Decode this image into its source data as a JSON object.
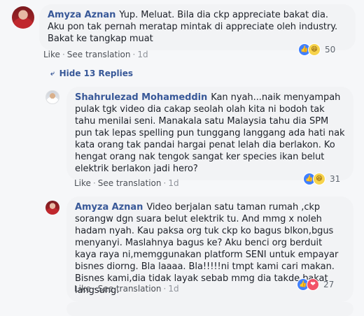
{
  "comments": [
    {
      "author": "Amyza Aznan",
      "text": "Yup. Meluat. Bila dia ckp appreciate bakat dia. Aku pon tak pernah meratap mintak di appreciate oleh industry. Bakat ke tangkap muat",
      "like_label": "Like",
      "translate_label": "See translation",
      "time": "1d",
      "reaction_icons": [
        "like-icon",
        "haha-icon"
      ],
      "reaction_count": "50"
    }
  ],
  "hide_replies_label": "Hide 13 Replies",
  "replies": [
    {
      "author": "Shahrulezad Mohameddin",
      "text": "Kan nyah...naik menyampah pulak tgk video dia cakap seolah olah kita ni bodoh tak tahu menilai seni. Manakala satu Malaysia tahu dia SPM pun tak lepas spelling pun tunggang langgang ada hati nak kata orang tak pandai hargai penat lelah dia berlakon. Ko hengat orang nak tengok sangat ker species ikan belut elektrik berlakon jadi hero?",
      "like_label": "Like",
      "translate_label": "See translation",
      "time": "1d",
      "reaction_icons": [
        "like-icon",
        "haha-icon"
      ],
      "reaction_count": "31"
    },
    {
      "author": "Amyza Aznan",
      "text": "Video berjalan satu taman rumah ,ckp sorangw dgn suara belut elektrik tu. And mmg x noleh hadam nyah. Kau paksa org tuk ckp ko bagus blkon,bgus menyanyi. Maslahnya bagus ke? Aku benci org berduit kaya raya ni,memggunakan platform SENI untuk empayar bisnes diorng. Bla laaaa. Bla!!!!!ni tmpt kami cari makan. Bisnes kami,dia tidak layak sebab mmg dia takde bakat langsung.",
      "like_label": "Like",
      "translate_label": "See translation",
      "time": "1d",
      "reaction_icons": [
        "like-icon",
        "love-icon"
      ],
      "reaction_count": "27"
    }
  ],
  "colors": {
    "author": "#385898",
    "bubble": "#f2f3f5",
    "like": "#4080ff",
    "haha": "#f7d34b",
    "love": "#f25268"
  }
}
